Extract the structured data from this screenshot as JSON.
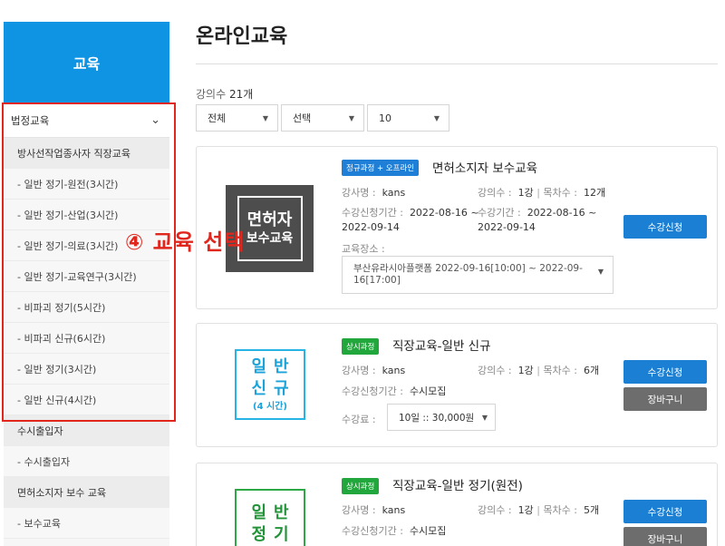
{
  "sidebar": {
    "header": "교육",
    "category": "법정교육",
    "groups": [
      {
        "title": "방사선작업종사자 직장교육",
        "items": [
          "- 일반 정기-원전(3시간)",
          "- 일반 정기-산업(3시간)",
          "- 일반 정기-의료(3시간)",
          "- 일반 정기-교육연구(3시간)",
          "- 비파괴 정기(5시간)",
          "- 비파괴 신규(6시간)",
          "- 일반 정기(3시간)",
          "- 일반 신규(4시간)"
        ]
      },
      {
        "title": "수시출입자",
        "items": [
          "- 수시출입자"
        ]
      },
      {
        "title": "면허소지자 보수 교육",
        "items": [
          "- 보수교육"
        ]
      }
    ]
  },
  "annotation": "④ 교육 선택",
  "main": {
    "title": "온라인교육",
    "count_label": "강의수",
    "count_value": "21개",
    "filters": [
      "전체",
      "선택",
      "10"
    ],
    "labels": {
      "instructor": "강사명 :",
      "lectures": "강의수 :",
      "lectures_unit": "1강",
      "toc": "목차수 :",
      "apply_period": "수강신청기간 :",
      "study_period": "수강기간 :",
      "place": "교육장소 :",
      "fee": "수강료 :",
      "recruit": "수시모집",
      "apply_button": "수강신청",
      "cart_button": "장바구니"
    },
    "courses": [
      {
        "badge": "정규과정 + 오프라인",
        "title": "면허소지자 보수교육",
        "thumb": [
          "면허자",
          "보수교육"
        ],
        "instructor": "kans",
        "toc": "12개",
        "apply_period": "2022-08-16 ~",
        "apply_period_end": "2022-09-14",
        "study_period": "2022-08-16 ~",
        "study_period_end": "2022-09-14",
        "place": "부산유라시아플랫폼 2022-09-16[10:00] ~ 2022-09-16[17:00]"
      },
      {
        "badge": "상시과정",
        "title": "직장교육-일반 신규",
        "thumb": [
          "일반",
          "신규",
          "(4 시간)"
        ],
        "instructor": "kans",
        "toc": "6개",
        "fee": "10일 :: 30,000원"
      },
      {
        "badge": "상시과정",
        "title": "직장교육-일반 정기(원전)",
        "thumb": [
          "일반",
          "정기"
        ],
        "instructor": "kans",
        "toc": "5개"
      }
    ]
  },
  "colors": {
    "brand": "#0f94e3",
    "annotation": "#e0261d",
    "badge_blue": "#1f7fd6",
    "badge_green": "#22a73c"
  }
}
